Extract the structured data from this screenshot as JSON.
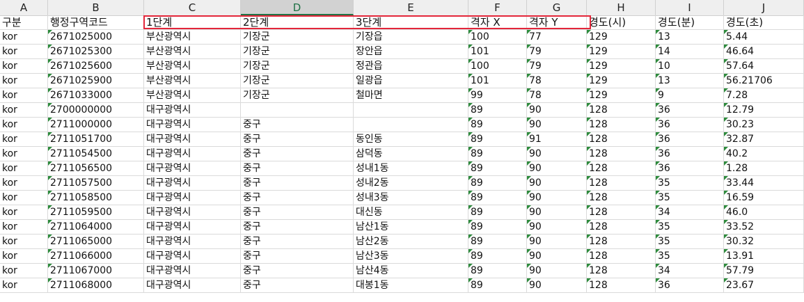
{
  "columns": [
    "A",
    "B",
    "C",
    "D",
    "E",
    "F",
    "G",
    "H",
    "I",
    "J"
  ],
  "selected_column": "D",
  "header_row": [
    "구분",
    "행정구역코드",
    "1단계",
    "2단계",
    "3단계",
    "격자 X",
    "격자 Y",
    "경도(시)",
    "경도(분)",
    "경도(초)"
  ],
  "rows": [
    [
      "kor",
      "2671025000",
      "부산광역시",
      "기장군",
      "기장읍",
      "100",
      "77",
      "129",
      "13",
      "5.44"
    ],
    [
      "kor",
      "2671025300",
      "부산광역시",
      "기장군",
      "장안읍",
      "101",
      "79",
      "129",
      "14",
      "46.64"
    ],
    [
      "kor",
      "2671025600",
      "부산광역시",
      "기장군",
      "정관읍",
      "100",
      "79",
      "129",
      "10",
      "57.64"
    ],
    [
      "kor",
      "2671025900",
      "부산광역시",
      "기장군",
      "일광읍",
      "101",
      "78",
      "129",
      "13",
      "56.21706"
    ],
    [
      "kor",
      "2671033000",
      "부산광역시",
      "기장군",
      "철마면",
      "99",
      "78",
      "129",
      "9",
      "7.28"
    ],
    [
      "kor",
      "2700000000",
      "대구광역시",
      "",
      "",
      "89",
      "90",
      "128",
      "36",
      "12.79"
    ],
    [
      "kor",
      "2711000000",
      "대구광역시",
      "중구",
      "",
      "89",
      "90",
      "128",
      "36",
      "30.23"
    ],
    [
      "kor",
      "2711051700",
      "대구광역시",
      "중구",
      "동인동",
      "89",
      "91",
      "128",
      "36",
      "32.87"
    ],
    [
      "kor",
      "2711054500",
      "대구광역시",
      "중구",
      "삼덕동",
      "89",
      "90",
      "128",
      "36",
      "40.2"
    ],
    [
      "kor",
      "2711056500",
      "대구광역시",
      "중구",
      "성내1동",
      "89",
      "90",
      "128",
      "36",
      "1.28"
    ],
    [
      "kor",
      "2711057500",
      "대구광역시",
      "중구",
      "성내2동",
      "89",
      "90",
      "128",
      "35",
      "33.44"
    ],
    [
      "kor",
      "2711058500",
      "대구광역시",
      "중구",
      "성내3동",
      "89",
      "90",
      "128",
      "35",
      "16.59"
    ],
    [
      "kor",
      "2711059500",
      "대구광역시",
      "중구",
      "대신동",
      "89",
      "90",
      "128",
      "34",
      "46.0"
    ],
    [
      "kor",
      "2711064000",
      "대구광역시",
      "중구",
      "남산1동",
      "89",
      "90",
      "128",
      "35",
      "33.52"
    ],
    [
      "kor",
      "2711065000",
      "대구광역시",
      "중구",
      "남산2동",
      "89",
      "90",
      "128",
      "35",
      "30.32"
    ],
    [
      "kor",
      "2711066000",
      "대구광역시",
      "중구",
      "남산3동",
      "89",
      "90",
      "128",
      "35",
      "13.91"
    ],
    [
      "kor",
      "2711067000",
      "대구광역시",
      "중구",
      "남산4동",
      "89",
      "90",
      "128",
      "34",
      "57.79"
    ],
    [
      "kor",
      "2711068000",
      "대구광역시",
      "중구",
      "대봉1동",
      "89",
      "90",
      "128",
      "36",
      "23.67"
    ]
  ]
}
